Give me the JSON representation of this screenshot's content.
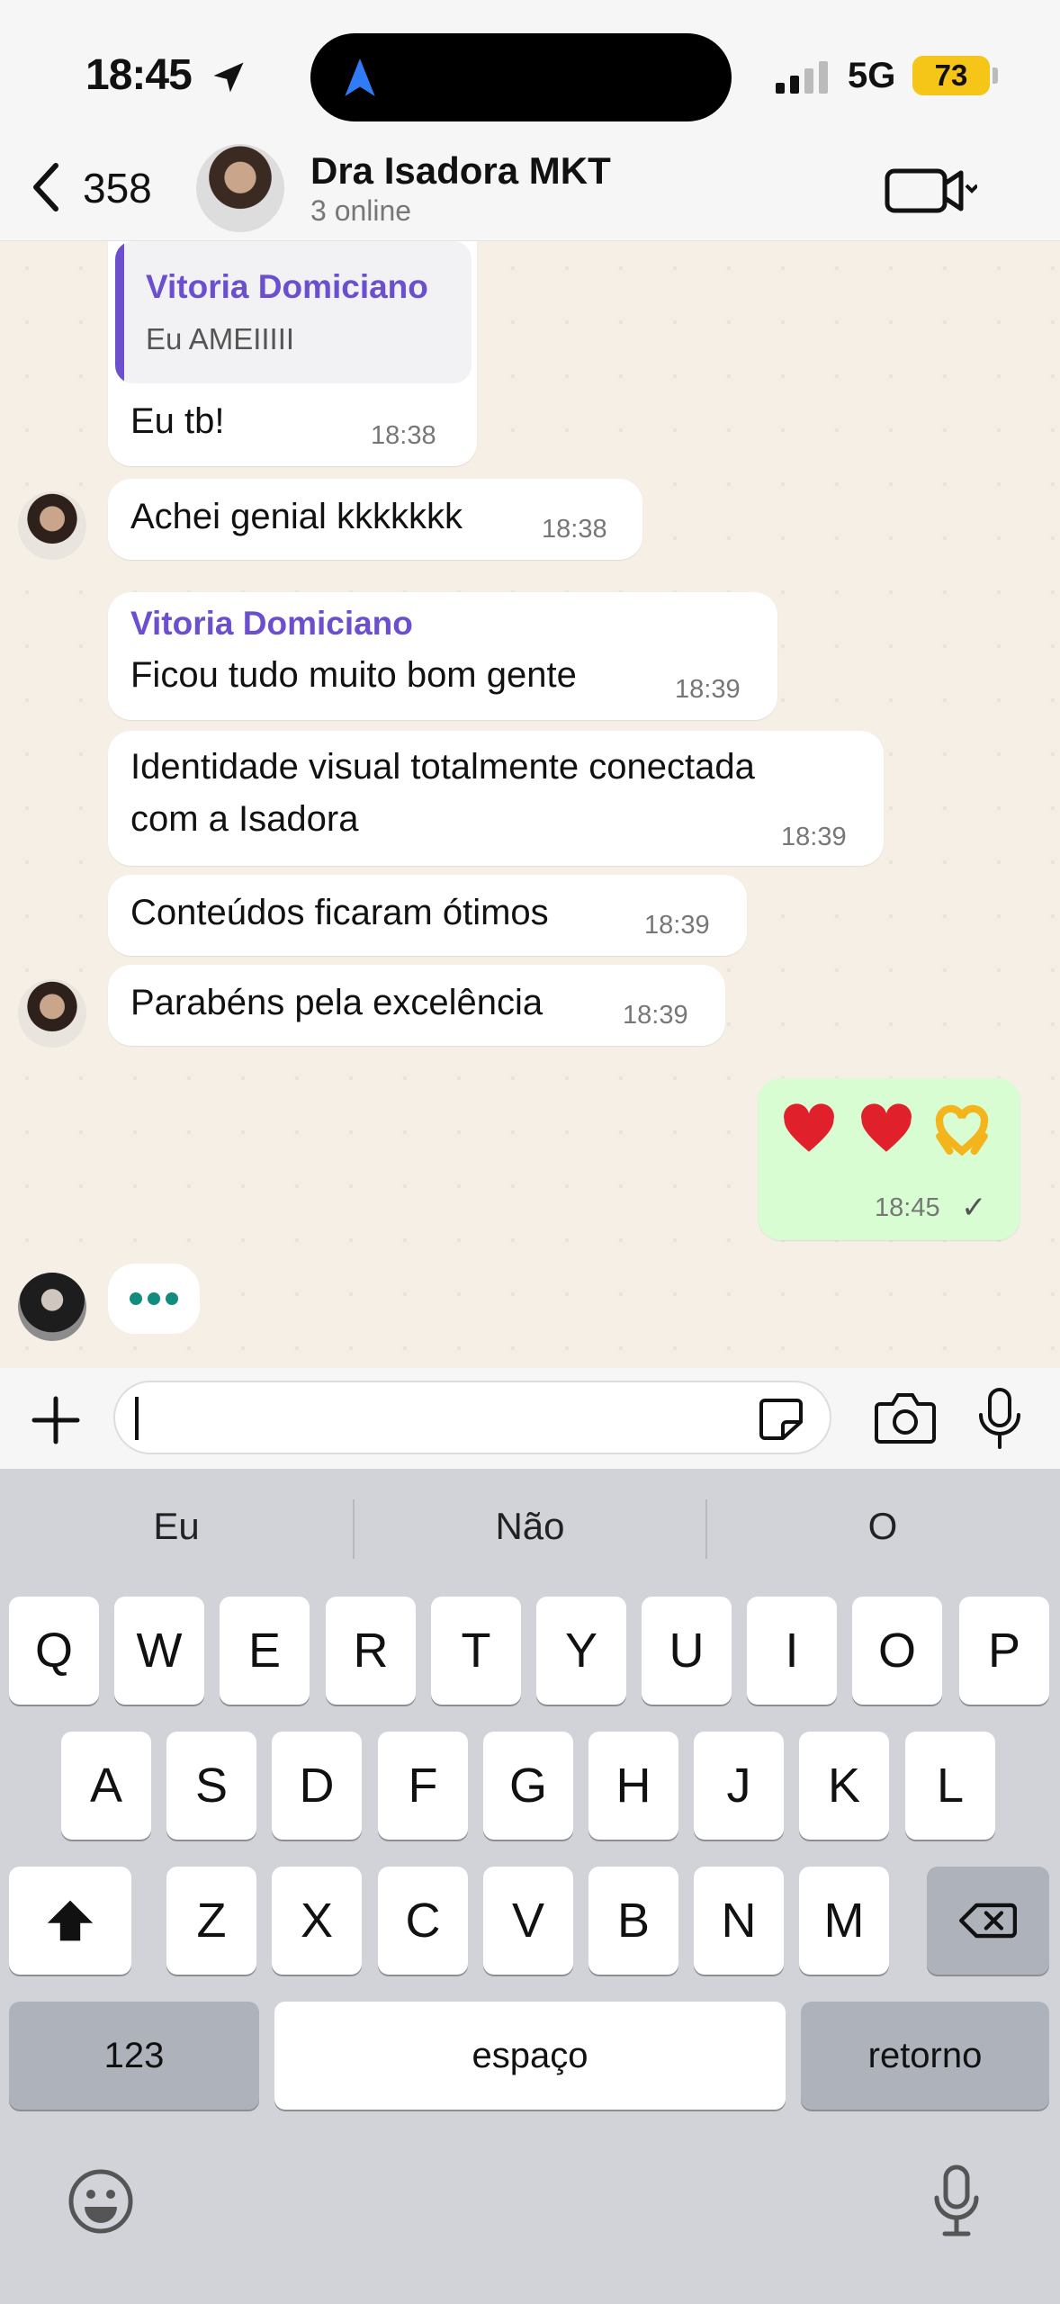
{
  "status_bar": {
    "time": "18:45",
    "network": "5G",
    "battery": "73"
  },
  "header": {
    "back_count": "358",
    "title": "Dra Isadora MKT",
    "subtitle": "3 online"
  },
  "messages": {
    "m1": {
      "quote_name": "Vitoria Domiciano",
      "quote_text": "Eu AMEIIIII",
      "text": "Eu tb!",
      "time": "18:38"
    },
    "m2": {
      "text": "Achei genial kkkkkkk",
      "time": "18:38"
    },
    "m3": {
      "sender": "Vitoria Domiciano",
      "text": "Ficou tudo muito bom gente",
      "time": "18:39"
    },
    "m4": {
      "line1": "Identidade visual totalmente conectada",
      "line2": "com a Isadora",
      "time": "18:39"
    },
    "m5": {
      "text": "Conteúdos ficaram ótimos",
      "time": "18:39"
    },
    "m6": {
      "text": "Parabéns pela excelência",
      "time": "18:39"
    },
    "m7": {
      "time": "18:45",
      "status": "✓"
    }
  },
  "input": {
    "placeholder": ""
  },
  "keyboard": {
    "suggestions": [
      "Eu",
      "Não",
      "O"
    ],
    "row1": [
      "Q",
      "W",
      "E",
      "R",
      "T",
      "Y",
      "U",
      "I",
      "O",
      "P"
    ],
    "row2": [
      "A",
      "S",
      "D",
      "F",
      "G",
      "H",
      "J",
      "K",
      "L"
    ],
    "row3": [
      "Z",
      "X",
      "C",
      "V",
      "B",
      "N",
      "M"
    ],
    "numbers_label": "123",
    "space_label": "espaço",
    "return_label": "retorno"
  },
  "colors": {
    "outgoing_bubble": "#d9fdd3",
    "sender_name": "#6b4fcf",
    "accent": "#128c7e",
    "battery": "#f5c518"
  }
}
